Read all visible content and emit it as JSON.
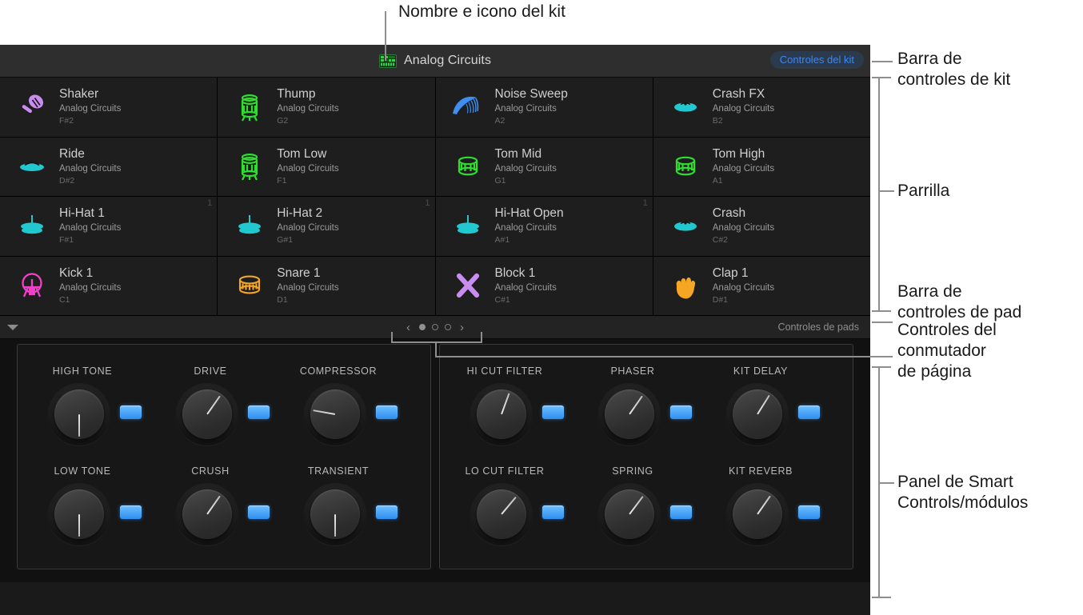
{
  "annotations": [
    {
      "id": "kit-name-icon",
      "text": "Nombre e icono del kit"
    },
    {
      "id": "kit-control-bar",
      "text": "Barra de\ncontroles de kit"
    },
    {
      "id": "grid",
      "text": "Parrilla"
    },
    {
      "id": "pad-control-bar",
      "text": "Barra de\ncontroles de pad"
    },
    {
      "id": "page-switcher",
      "text": "Controles del\nconmutador\nde página"
    },
    {
      "id": "smart-controls-panel",
      "text": "Panel de Smart\nControls/módulos"
    }
  ],
  "kit_bar": {
    "kit_name": "Analog Circuits",
    "kit_icon": "drum-machine-grid-icon",
    "kit_controls_label": "Controles del kit",
    "accent_color": "#3d87ef",
    "pill_bg": "#2b3a4c"
  },
  "grid": {
    "pads": [
      {
        "name": "Shaker",
        "sub": "Analog Circuits",
        "note": "F#2",
        "num": "",
        "icon": "shaker-icon",
        "color": "#c98cf0"
      },
      {
        "name": "Thump",
        "sub": "Analog Circuits",
        "note": "G2",
        "num": "",
        "icon": "tom-tall-icon",
        "color": "#2ee02e"
      },
      {
        "name": "Noise Sweep",
        "sub": "Analog Circuits",
        "note": "A2",
        "num": "",
        "icon": "noise-sweep-icon",
        "color": "#3d8ef0"
      },
      {
        "name": "Crash FX",
        "sub": "Analog Circuits",
        "note": "B2",
        "num": "",
        "icon": "cymbal-flat-icon",
        "color": "#22c8cf"
      },
      {
        "name": "Ride",
        "sub": "Analog Circuits",
        "note": "D#2",
        "num": "",
        "icon": "ride-icon",
        "color": "#22c8cf"
      },
      {
        "name": "Tom Low",
        "sub": "Analog Circuits",
        "note": "F1",
        "num": "",
        "icon": "tom-tall-icon",
        "color": "#2ee02e"
      },
      {
        "name": "Tom Mid",
        "sub": "Analog Circuits",
        "note": "G1",
        "num": "",
        "icon": "tom-icon",
        "color": "#2ee02e"
      },
      {
        "name": "Tom High",
        "sub": "Analog Circuits",
        "note": "A1",
        "num": "",
        "icon": "tom-icon",
        "color": "#2ee02e"
      },
      {
        "name": "Hi-Hat 1",
        "sub": "Analog Circuits",
        "note": "F#1",
        "num": "1",
        "icon": "hihat-icon",
        "color": "#22c8cf"
      },
      {
        "name": "Hi-Hat 2",
        "sub": "Analog Circuits",
        "note": "G#1",
        "num": "1",
        "icon": "hihat-icon",
        "color": "#22c8cf"
      },
      {
        "name": "Hi-Hat Open",
        "sub": "Analog Circuits",
        "note": "A#1",
        "num": "1",
        "icon": "hihat-icon",
        "color": "#22c8cf"
      },
      {
        "name": "Crash",
        "sub": "Analog Circuits",
        "note": "C#2",
        "num": "",
        "icon": "cymbal-flat-icon",
        "color": "#22c8cf"
      },
      {
        "name": "Kick 1",
        "sub": "Analog Circuits",
        "note": "C1",
        "num": "",
        "icon": "kick-icon",
        "color": "#f040c8"
      },
      {
        "name": "Snare 1",
        "sub": "Analog Circuits",
        "note": "D1",
        "num": "",
        "icon": "snare-icon",
        "color": "#f5a623"
      },
      {
        "name": "Block 1",
        "sub": "Analog Circuits",
        "note": "C#1",
        "num": "",
        "icon": "sticks-icon",
        "color": "#c98cf0"
      },
      {
        "name": "Clap 1",
        "sub": "Analog Circuits",
        "note": "D#1",
        "num": "",
        "icon": "clap-hand-icon",
        "color": "#f5a623"
      }
    ]
  },
  "pad_bar": {
    "disclosure_icon": "triangle-down-icon",
    "prev_icon": "chevron-left-icon",
    "next_icon": "chevron-right-icon",
    "prev_glyph": "‹",
    "next_glyph": "›",
    "pages": 3,
    "current_page": 1,
    "pad_controls_label": "Controles de pads"
  },
  "smart_controls": {
    "modules": [
      {
        "id": "module-left",
        "knobs": [
          {
            "label": "HIGH TONE",
            "angle": 0,
            "button_on": true
          },
          {
            "label": "DRIVE",
            "angle": -145,
            "button_on": true
          },
          {
            "label": "COMPRESSOR",
            "angle": 100,
            "button_on": true
          },
          {
            "label": "LOW TONE",
            "angle": 0,
            "button_on": true
          },
          {
            "label": "CRUSH",
            "angle": -145,
            "button_on": true
          },
          {
            "label": "TRANSIENT",
            "angle": 0,
            "button_on": true
          }
        ]
      },
      {
        "id": "module-right",
        "knobs": [
          {
            "label": "HI CUT FILTER",
            "angle": -160,
            "button_on": true
          },
          {
            "label": "PHASER",
            "angle": -145,
            "button_on": true
          },
          {
            "label": "KIT DELAY",
            "angle": -148,
            "button_on": true
          },
          {
            "label": "LO CUT FILTER",
            "angle": -140,
            "button_on": true
          },
          {
            "label": "SPRING",
            "angle": -143,
            "button_on": true
          },
          {
            "label": "KIT REVERB",
            "angle": -145,
            "button_on": true
          }
        ]
      }
    ]
  }
}
